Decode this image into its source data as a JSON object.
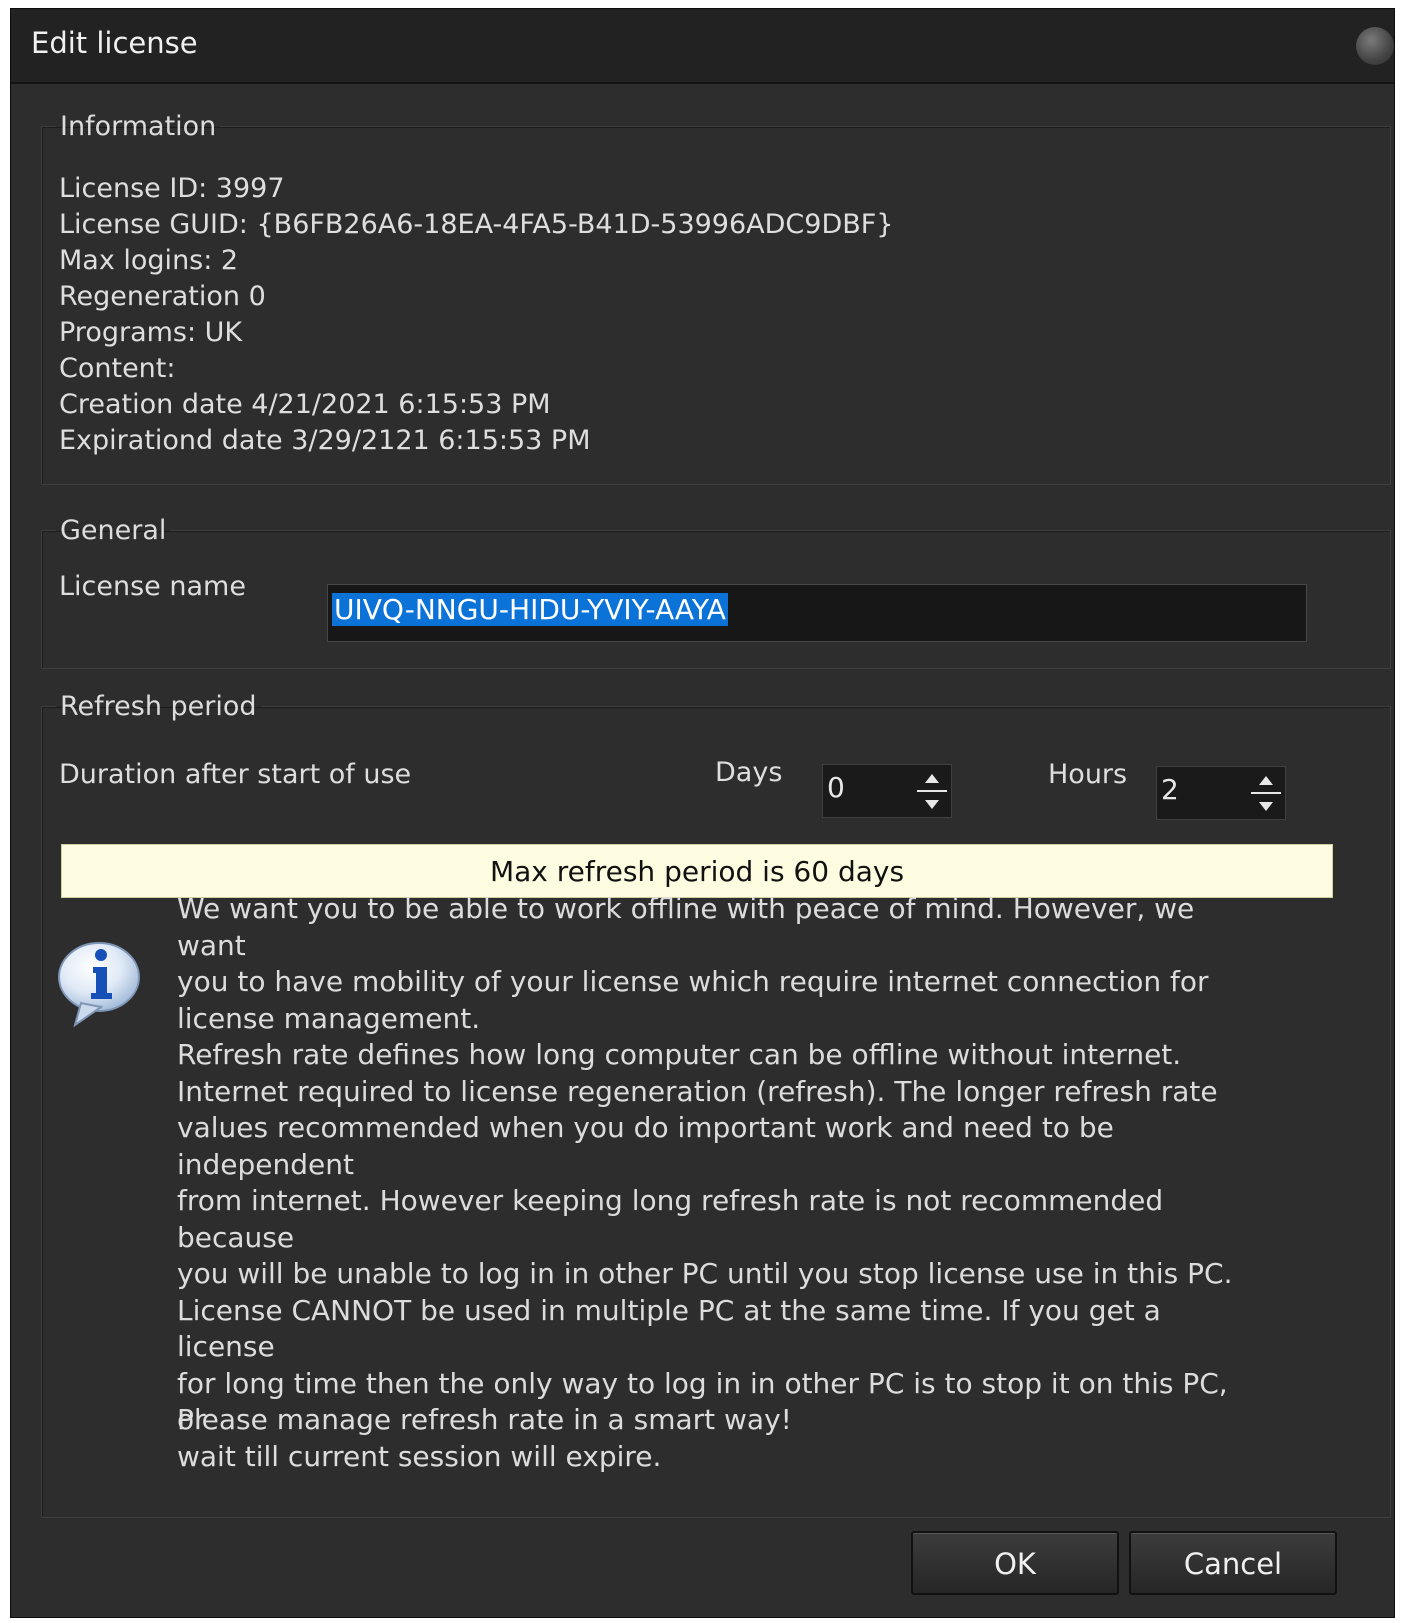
{
  "window": {
    "title": "Edit license"
  },
  "information": {
    "legend": "Information",
    "lines": [
      "License ID: 3997",
      "License GUID: {B6FB26A6-18EA-4FA5-B41D-53996ADC9DBF}",
      "Max logins: 2",
      "Regeneration 0",
      "Programs: UK",
      "Content:",
      "Creation date 4/21/2021 6:15:53 PM",
      "Expirationd date 3/29/2121 6:15:53 PM"
    ]
  },
  "general": {
    "legend": "General",
    "license_name_label": "License name",
    "license_name_value": "UIVQ-NNGU-HIDU-YVIY-AAYA"
  },
  "refresh": {
    "legend": "Refresh period",
    "duration_label": "Duration after start of use",
    "days_label": "Days",
    "days_value": "0",
    "hours_label": "Hours",
    "hours_value": "2",
    "notice": "Max refresh period is 60 days",
    "para1": "We want you to be able to work offline with peace of mind. However, we want\nyou to have mobility of your license which require internet connection for\nlicense management.",
    "para2": "Refresh rate defines how long computer can be offline without internet.\nInternet required to license regeneration (refresh). The longer refresh rate\nvalues recommended when you do important work and need to be independent\nfrom internet. However keeping long refresh rate is not recommended because\nyou will be unable to log in in other PC until you stop license use in this PC.\nLicense CANNOT be used in multiple PC at the same time. If you get a license\nfor long time then the only way to log in in other PC is to stop it on this PC, or\nwait till current session will expire.",
    "para3": "Please manage refresh rate in a smart way!"
  },
  "buttons": {
    "ok": "OK",
    "cancel": "Cancel"
  },
  "icons": {
    "info": "info-icon",
    "close": "close-orb-icon"
  }
}
